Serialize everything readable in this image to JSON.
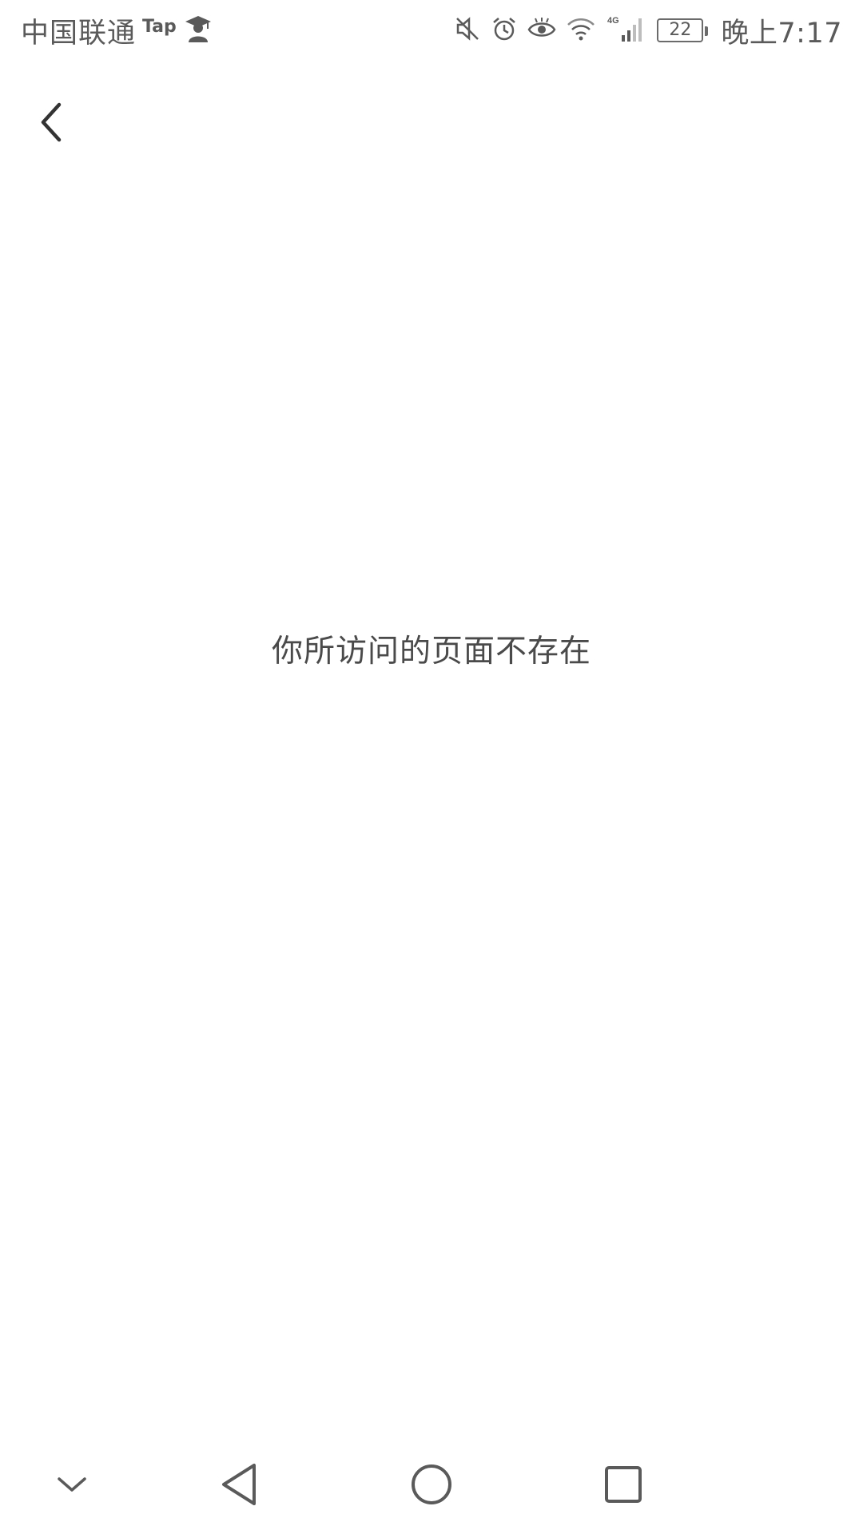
{
  "status_bar": {
    "carrier": "中国联通",
    "tap_label": "Tap",
    "battery_level": "22",
    "time": "晚上7:17",
    "icons": [
      "scholar-icon",
      "mute-icon",
      "alarm-icon",
      "eye-icon",
      "wifi-icon",
      "signal-4g-icon",
      "battery-icon"
    ]
  },
  "header": {
    "back_icon": "chevron-left-icon"
  },
  "main": {
    "message": "你所访问的页面不存在"
  },
  "nav_bar": {
    "icons": [
      "chevron-down-icon",
      "triangle-back-icon",
      "circle-home-icon",
      "square-recent-icon"
    ]
  },
  "colors": {
    "background": "#ffffff",
    "text": "#4a4a4a",
    "status": "#5a5a5a"
  }
}
